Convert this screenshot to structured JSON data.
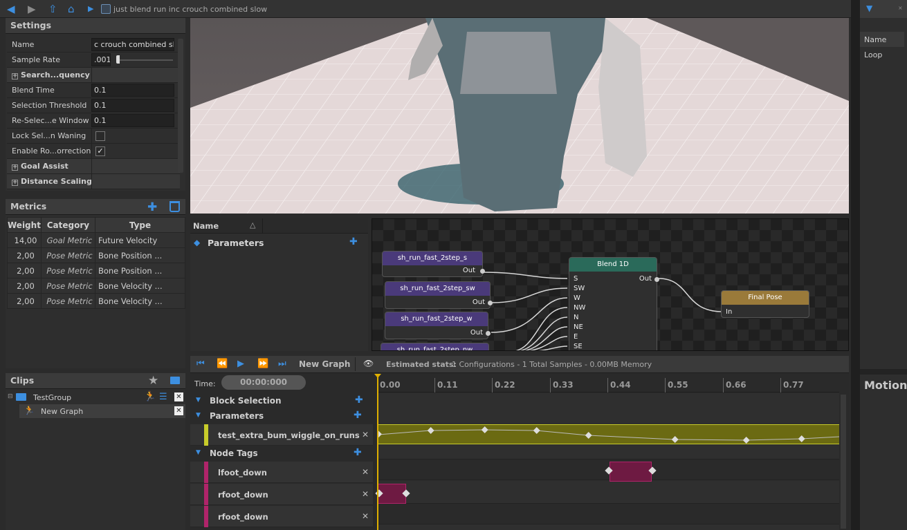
{
  "topbar": {
    "breadcrumb": "just blend run inc crouch combined slow"
  },
  "settings": {
    "title": "Settings",
    "rows": [
      {
        "label": "Name",
        "value": "c crouch combined slow"
      },
      {
        "label": "Sample Rate",
        "value": ".001"
      },
      {
        "label": "Search...quency",
        "value": ""
      },
      {
        "label": "Blend Time",
        "value": "0.1"
      },
      {
        "label": "Selection Threshold",
        "value": "0.1"
      },
      {
        "label": "Re-Selec...e Window",
        "value": "0.1"
      },
      {
        "label": "Lock Sel...n Waning",
        "value": ""
      },
      {
        "label": "Enable Ro...orrection",
        "value": "✓"
      },
      {
        "label": "Goal Assist",
        "value": ""
      },
      {
        "label": "Distance Scaling",
        "value": ""
      }
    ]
  },
  "metrics": {
    "title": "Metrics",
    "headers": [
      "Weight",
      "Category",
      "Type"
    ],
    "rows": [
      [
        "14,00",
        "Goal Metric",
        "Future Velocity"
      ],
      [
        "2,00",
        "Pose Metric",
        "Bone Position ..."
      ],
      [
        "2,00",
        "Pose Metric",
        "Bone Position ..."
      ],
      [
        "2,00",
        "Pose Metric",
        "Bone Velocity ..."
      ],
      [
        "2,00",
        "Pose Metric",
        "Bone Velocity ..."
      ]
    ]
  },
  "clips": {
    "title": "Clips",
    "group": "TestGroup",
    "item": "New Graph"
  },
  "params": {
    "name_header": "Name",
    "section": "Parameters"
  },
  "graph": {
    "clip_nodes": [
      "sh_run_fast_2step_s",
      "sh_run_fast_2step_sw",
      "sh_run_fast_2step_w",
      "sh_run_fast_2step_nw"
    ],
    "out_label": "Out",
    "blend_title": "Blend 1D",
    "blend_inputs": [
      "S",
      "SW",
      "W",
      "NW",
      "N",
      "NE",
      "E",
      "SE"
    ],
    "final_title": "Final Pose",
    "in_label": "In"
  },
  "timeline": {
    "graph_name": "New Graph",
    "stats_label": "Estimated stats:",
    "stats_value": "1 Configurations - 1 Total Samples - 0.00MB Memory",
    "time_label": "Time:",
    "time_value": "00:00:000",
    "ticks": [
      "0.00",
      "0.11",
      "0.22",
      "0.33",
      "0.44",
      "0.55",
      "0.66",
      "0.77"
    ],
    "sections": [
      "Block Selection",
      "Parameters",
      "Node Tags"
    ],
    "param_track": "test_extra_bum_wiggle_on_runs",
    "tag_tracks": [
      "lfoot_down",
      "rfoot_down",
      "rfoot_down"
    ]
  },
  "right": {
    "name_label": "Name",
    "loop_label": "Loop",
    "motion_label": "Motion"
  },
  "colors": {
    "accent": "#3d8fe0",
    "param_track": "#c8cc2a",
    "tag_track": "#b0246a",
    "clip_node": "#4a3a7a",
    "blend_node": "#2a6a5a",
    "final_node": "#9a7a3a"
  }
}
